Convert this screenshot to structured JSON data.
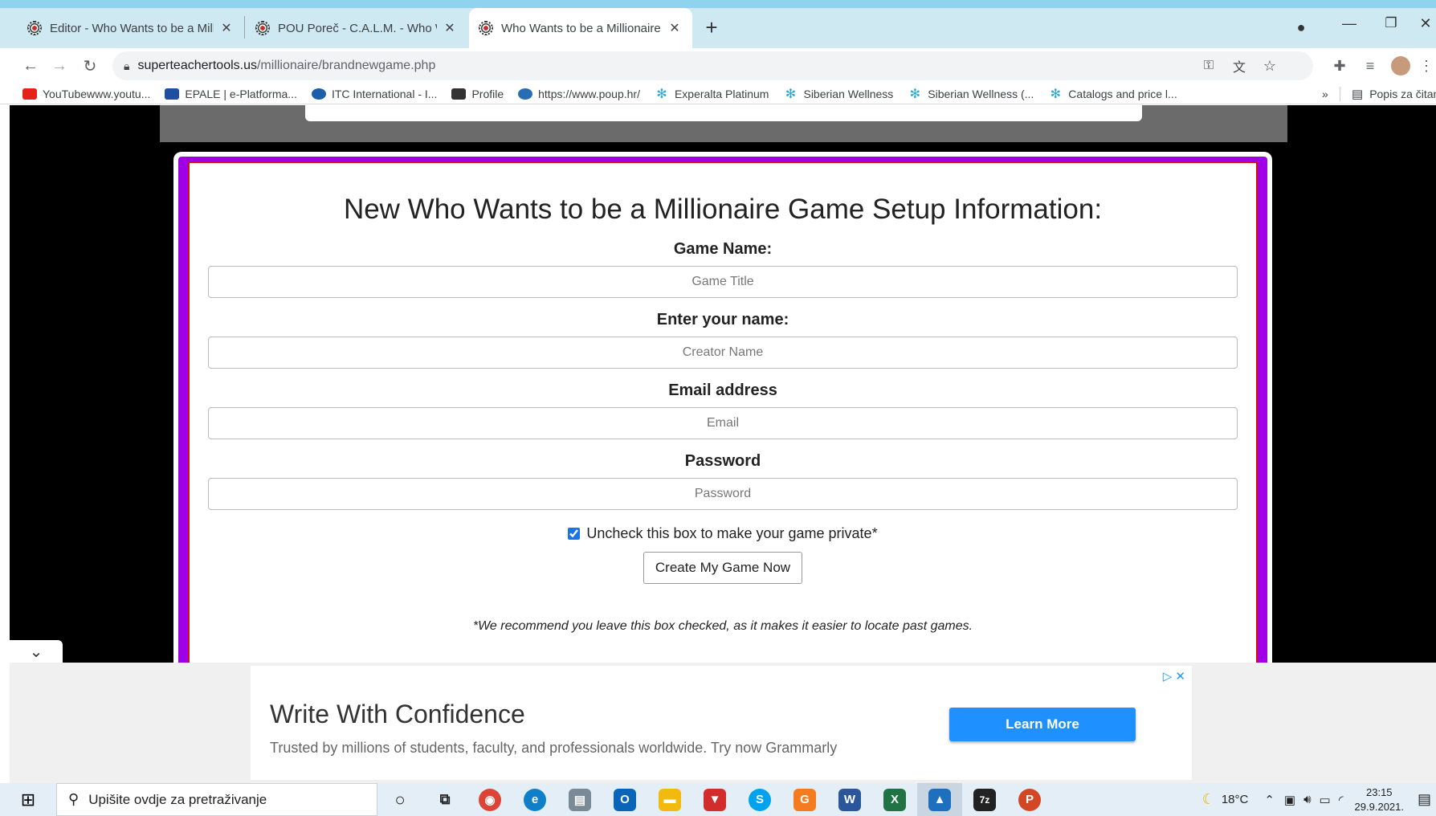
{
  "tabs": [
    {
      "title": "Editor - Who Wants to be a Millio",
      "active": false
    },
    {
      "title": "POU Poreč - C.A.L.M. - Who Wan",
      "active": false
    },
    {
      "title": "Who Wants to be a Millionaire St",
      "active": true
    }
  ],
  "new_tab_glyph": "+",
  "address": {
    "domain": "superteachertools.us",
    "path": "/millionaire/brandnewgame.php"
  },
  "bookmarks": [
    {
      "label": "YouTubewww.youtu...",
      "color": "#e62117"
    },
    {
      "label": "EPALE | e-Platforma...",
      "color": "#1f4fa0"
    },
    {
      "label": "ITC International - I...",
      "color": "#1b5fab"
    },
    {
      "label": "Profile",
      "color": "#333333"
    },
    {
      "label": "https://www.poup.hr/",
      "color": "#2a6cb3"
    },
    {
      "label": "Experalta Platinum",
      "color": "#2aa9d6"
    },
    {
      "label": "Siberian Wellness",
      "color": "#2aa9d6"
    },
    {
      "label": "Siberian Wellness (...",
      "color": "#2aa9d6"
    },
    {
      "label": "Catalogs and price l...",
      "color": "#2aa9d6"
    }
  ],
  "bookmarks_overflow": "»",
  "reading_list": "Popis za čitanje",
  "form": {
    "heading": "New Who Wants to be a Millionaire Game Setup Information:",
    "game_name_label": "Game Name:",
    "game_name_placeholder": "Game Title",
    "your_name_label": "Enter your name:",
    "your_name_placeholder": "Creator Name",
    "email_label": "Email address",
    "email_placeholder": "Email",
    "password_label": "Password",
    "password_placeholder": "Password",
    "public_checkbox_label": "Uncheck this box to make your game private*",
    "public_checked": true,
    "create_button": "Create My Game Now",
    "footnote": "*We recommend you leave this box checked, as it makes it easier to locate past games."
  },
  "ad": {
    "title": "Write With Confidence",
    "subtitle": "Trusted by millions of students, faculty, and professionals worldwide. Try now Grammarly",
    "button": "Learn More"
  },
  "taskbar": {
    "search_placeholder": "Upišite ovdje za pretraživanje",
    "apps": [
      {
        "name": "chrome",
        "color": "#db4437",
        "glyph": "◉"
      },
      {
        "name": "edge",
        "color": "#0f7fc8",
        "glyph": "e"
      },
      {
        "name": "printer",
        "color": "#7a8a96",
        "glyph": "▤"
      },
      {
        "name": "outlook",
        "color": "#0a64b8",
        "glyph": "O"
      },
      {
        "name": "file-explorer",
        "color": "#f2b90f",
        "glyph": "▬"
      },
      {
        "name": "popcorn",
        "color": "#d12d2d",
        "glyph": "▼"
      },
      {
        "name": "skype",
        "color": "#00a2ed",
        "glyph": "S"
      },
      {
        "name": "app-g",
        "color": "#f47b20",
        "glyph": "G"
      },
      {
        "name": "word",
        "color": "#2b579a",
        "glyph": "W"
      },
      {
        "name": "excel",
        "color": "#217346",
        "glyph": "X"
      },
      {
        "name": "photos",
        "color": "#1f6fbf",
        "glyph": "▲"
      },
      {
        "name": "7zip",
        "color": "#222222",
        "glyph": "7z"
      },
      {
        "name": "powerpoint",
        "color": "#d24726",
        "glyph": "P"
      }
    ],
    "temperature": "18°C",
    "time": "23:15",
    "date": "29.9.2021."
  }
}
